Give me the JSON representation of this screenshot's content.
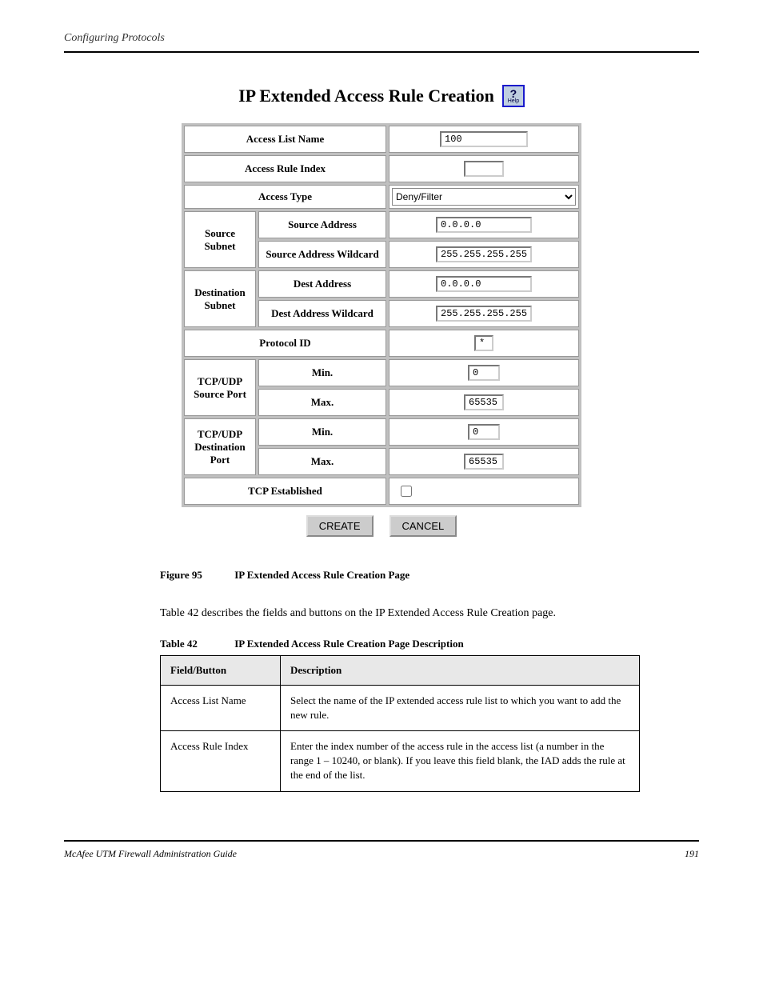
{
  "header": {
    "breadcrumb": "Configuring Protocols"
  },
  "title": "IP Extended Access Rule Creation",
  "help_label": "Help",
  "form": {
    "access_list_name": {
      "label": "Access List Name",
      "value": "100"
    },
    "access_rule_index": {
      "label": "Access Rule Index",
      "value": ""
    },
    "access_type": {
      "label": "Access Type",
      "value": "Deny/Filter"
    },
    "source_subnet": {
      "group_label": "Source Subnet",
      "address": {
        "label": "Source Address",
        "value": "0.0.0.0"
      },
      "wildcard": {
        "label": "Source Address Wildcard",
        "value": "255.255.255.255"
      }
    },
    "dest_subnet": {
      "group_label": "Destination Subnet",
      "address": {
        "label": "Dest Address",
        "value": "0.0.0.0"
      },
      "wildcard": {
        "label": "Dest Address Wildcard",
        "value": "255.255.255.255"
      }
    },
    "protocol_id": {
      "label": "Protocol ID",
      "value": "*"
    },
    "src_port": {
      "group_label": "TCP/UDP Source Port",
      "min": {
        "label": "Min.",
        "value": "0"
      },
      "max": {
        "label": "Max.",
        "value": "65535"
      }
    },
    "dst_port": {
      "group_label": "TCP/UDP Destination Port",
      "min": {
        "label": "Min.",
        "value": "0"
      },
      "max": {
        "label": "Max.",
        "value": "65535"
      }
    },
    "tcp_established": {
      "label": "TCP Established",
      "checked": false
    }
  },
  "buttons": {
    "create": "CREATE",
    "cancel": "CANCEL"
  },
  "figure": {
    "number": "Figure 95",
    "caption": "IP Extended Access Rule Creation Page"
  },
  "desc_intro": "Table 42 describes the fields and buttons on the IP Extended Access Rule Creation page.",
  "table_caption": {
    "number": "Table 42",
    "caption": "IP Extended Access Rule Creation Page Description"
  },
  "desc_table": {
    "headers": {
      "field": "Field/Button",
      "desc": "Description"
    },
    "rows": [
      {
        "field": "Access List Name",
        "desc": "Select the name of the IP extended access rule list to which you want to add the new rule."
      },
      {
        "field": "Access Rule Index",
        "desc": "Enter the index number of the access rule in the access list (a number in the range 1 – 10240, or blank). If you leave this field blank, the IAD adds the rule at the end of the list."
      }
    ]
  },
  "footer": {
    "left": "McAfee UTM Firewall Administration Guide",
    "right": "191"
  }
}
